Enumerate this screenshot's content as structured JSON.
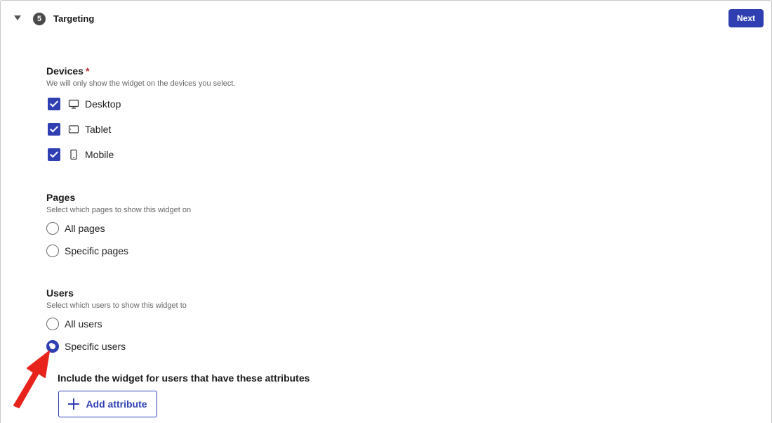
{
  "header": {
    "step_number": "5",
    "title": "Targeting",
    "next_label": "Next"
  },
  "devices": {
    "label": "Devices",
    "required_marker": "*",
    "help": "We will only show the widget on the devices you select.",
    "options": [
      {
        "label": "Desktop",
        "icon": "desktop-icon",
        "checked": true
      },
      {
        "label": "Tablet",
        "icon": "tablet-icon",
        "checked": true
      },
      {
        "label": "Mobile",
        "icon": "mobile-icon",
        "checked": true
      }
    ]
  },
  "pages": {
    "label": "Pages",
    "help": "Select which pages to show this widget on",
    "options": [
      {
        "label": "All pages",
        "selected": false
      },
      {
        "label": "Specific pages",
        "selected": false
      }
    ]
  },
  "users": {
    "label": "Users",
    "help": "Select which users to show this widget to",
    "options": [
      {
        "label": "All users",
        "selected": false
      },
      {
        "label": "Specific users",
        "selected": true
      }
    ],
    "include_label": "Include the widget for users that have these attributes",
    "add_attribute_label": "Add attribute"
  },
  "colors": {
    "accent": "#2f3fb2",
    "required": "#c0262d",
    "annotation_arrow": "#e8231c"
  }
}
